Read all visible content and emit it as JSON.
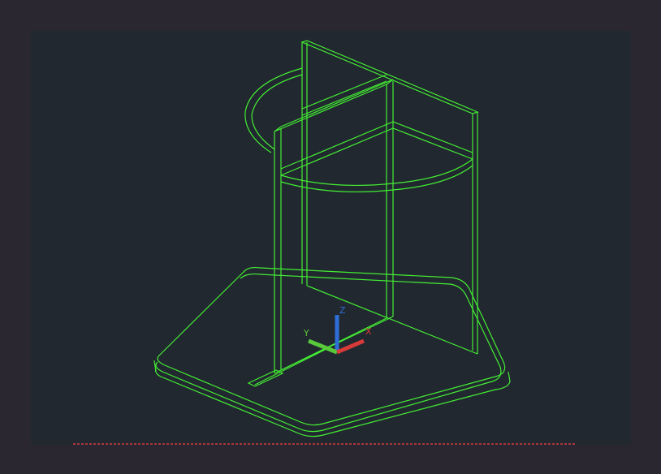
{
  "viewport": {
    "background": "#212830",
    "frame_background": "#2b2730",
    "wireframe_color": "#44ee33",
    "limit_line_color": "#d83a3a"
  },
  "ucs_icon": {
    "x_label": "X",
    "y_label": "Y",
    "z_label": "Z",
    "x_color": "#d83a3a",
    "y_color": "#59c83a",
    "z_color": "#2f6ed8"
  }
}
